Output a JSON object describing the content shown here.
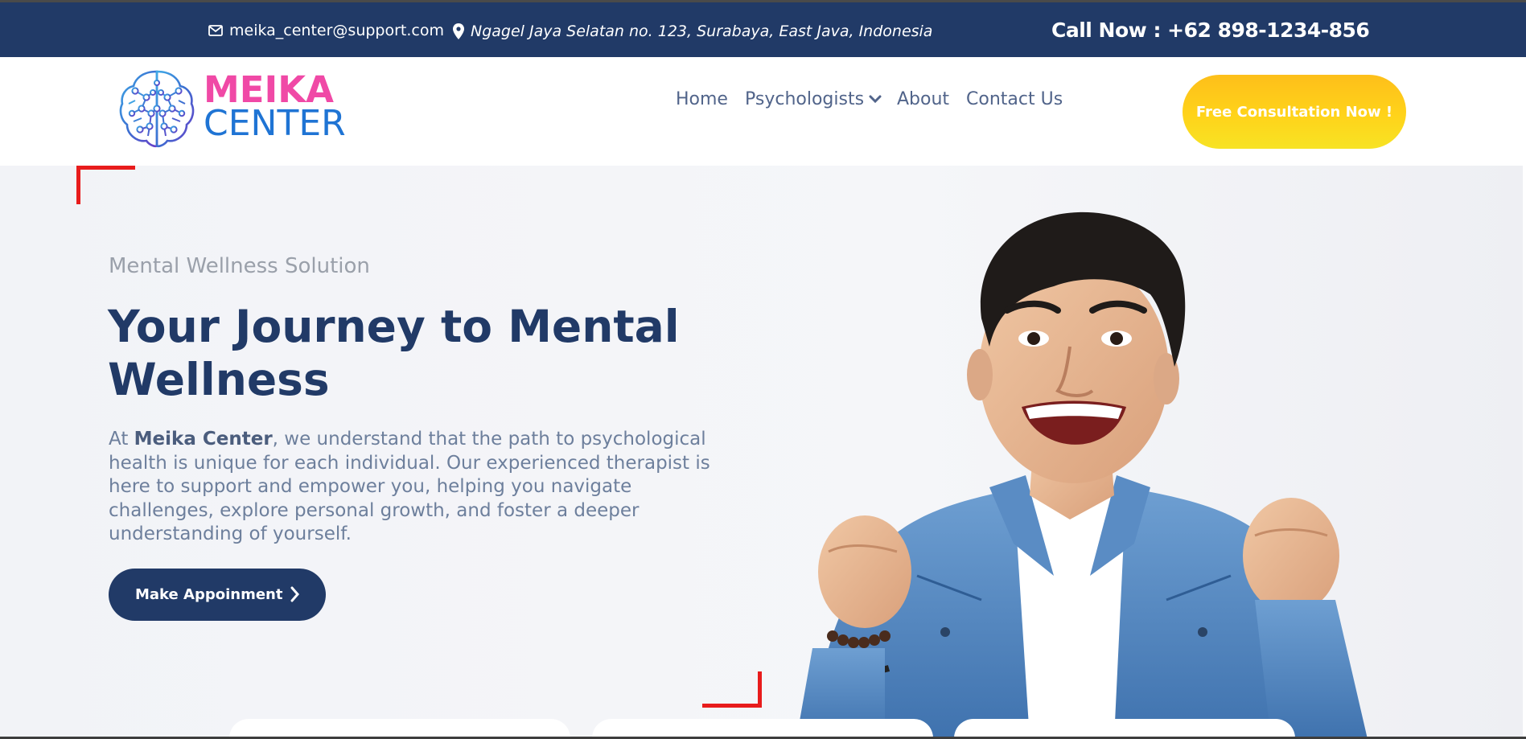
{
  "topbar": {
    "email": "meika_center@support.com",
    "address": "Ngagel Jaya Selatan no. 123, Surabaya, East Java, Indonesia",
    "call": "Call Now : +62 898-1234-856"
  },
  "logo": {
    "line1": "MEIKA",
    "line2": "CENTER"
  },
  "nav": {
    "home": "Home",
    "psychologists": "Psychologists",
    "about": "About",
    "contact": "Contact Us"
  },
  "cta": "Free Consultation Now !",
  "hero": {
    "tagline": "Mental Wellness Solution",
    "headline": "Your Journey to Mental Wellness",
    "desc_prefix": "At ",
    "desc_brand": "Meika Center",
    "desc_rest": ", we understand that the path to psychological health is unique for each individual. Our experienced therapist is here to support and empower you, helping you navigate challenges, explore personal growth, and foster a deeper understanding of yourself.",
    "button": "Make Appoinment"
  },
  "colors": {
    "navy": "#213a67",
    "pink": "#f049a6",
    "blue": "#1f74d4",
    "yellow": "#fdc51a",
    "red": "#e81c1c"
  },
  "icons": [
    "envelope-icon",
    "map-pin-icon",
    "brain-icon",
    "chevron-down-icon",
    "chevron-right-icon"
  ]
}
